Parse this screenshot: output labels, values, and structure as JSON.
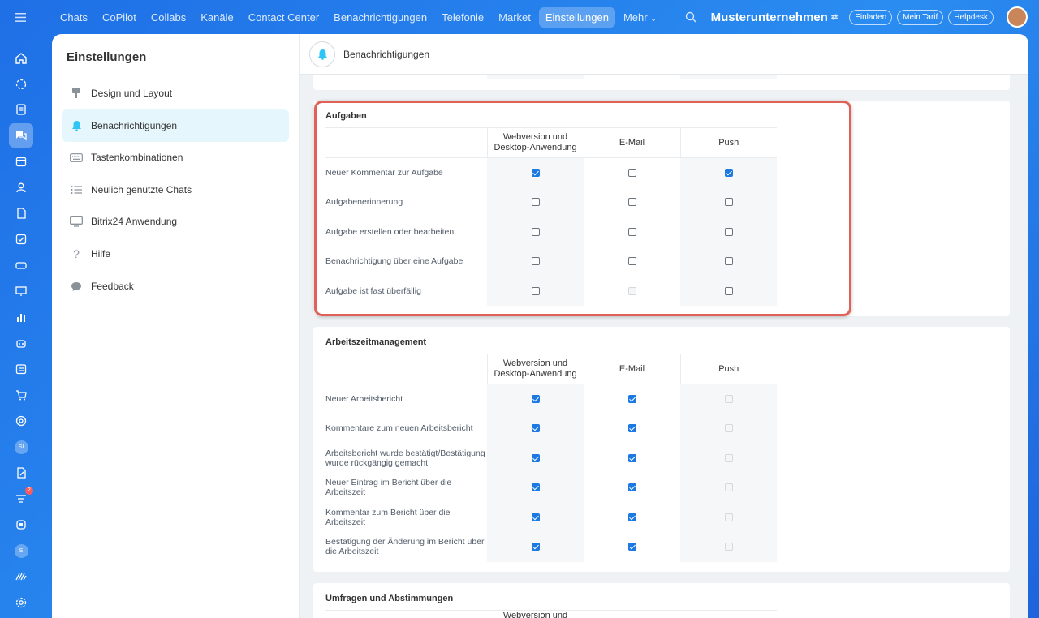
{
  "topnav": {
    "items": [
      "Chats",
      "CoPilot",
      "Collabs",
      "Kanäle",
      "Contact Center",
      "Benachrichtigungen",
      "Telefonie",
      "Market",
      "Einstellungen",
      "Mehr"
    ],
    "active_index": 8,
    "company": "Musterunternehmen",
    "buttons": [
      "Einladen",
      "Mein Tarif",
      "Helpdesk"
    ]
  },
  "rail": {
    "icons": [
      "home-icon",
      "copilot-icon",
      "feed-icon",
      "chat-icon",
      "calendar-icon",
      "contacts-icon",
      "docs-icon",
      "tasks-icon",
      "drive-icon",
      "presentation-icon",
      "analytics-icon",
      "robot-icon",
      "planner-icon",
      "shop-icon",
      "goals-icon",
      "si-avatar",
      "edit-icon",
      "filter-icon",
      "integrations-icon",
      "s-avatar",
      "bitrix-logo-icon",
      "settings-icon"
    ],
    "badge": "2",
    "circle_si": "SI",
    "circle_s": "S"
  },
  "sidebar": {
    "title": "Einstellungen",
    "items": [
      {
        "label": "Design und Layout",
        "icon": "brush-icon"
      },
      {
        "label": "Benachrichtigungen",
        "icon": "bell-icon"
      },
      {
        "label": "Tastenkombinationen",
        "icon": "keyboard-icon"
      },
      {
        "label": "Neulich genutzte Chats",
        "icon": "list-icon"
      },
      {
        "label": "Bitrix24 Anwendung",
        "icon": "monitor-icon"
      },
      {
        "label": "Hilfe",
        "icon": "question-icon"
      },
      {
        "label": "Feedback",
        "icon": "speech-bubble-icon"
      }
    ],
    "active_index": 1
  },
  "header": {
    "title": "Benachrichtigungen"
  },
  "columns": [
    "Webversion und Desktop-Anwendung",
    "E-Mail",
    "Push"
  ],
  "sections": {
    "aufgaben": {
      "title": "Aufgaben",
      "rows": [
        {
          "label": "Neuer Kommentar zur Aufgabe",
          "web": "on",
          "email": "off",
          "push": "on"
        },
        {
          "label": "Aufgabenerinnerung",
          "web": "off",
          "email": "off",
          "push": "off"
        },
        {
          "label": "Aufgabe erstellen oder bearbeiten",
          "web": "off",
          "email": "off",
          "push": "off"
        },
        {
          "label": "Benachrichtigung über eine Aufgabe",
          "web": "off",
          "email": "off",
          "push": "off"
        },
        {
          "label": "Aufgabe ist fast überfällig",
          "web": "off",
          "email": "disabled",
          "push": "off"
        }
      ]
    },
    "arbeitszeit": {
      "title": "Arbeitszeitmanagement",
      "rows": [
        {
          "label": "Neuer Arbeitsbericht",
          "web": "on",
          "email": "on",
          "push": "disabled"
        },
        {
          "label": "Kommentare zum neuen Arbeitsbericht",
          "web": "on",
          "email": "on",
          "push": "disabled"
        },
        {
          "label": "Arbeitsbericht wurde bestätigt/Bestätigung wurde rückgängig gemacht",
          "web": "on",
          "email": "on",
          "push": "disabled"
        },
        {
          "label": "Neuer Eintrag im Bericht über die Arbeitszeit",
          "web": "on",
          "email": "on",
          "push": "disabled"
        },
        {
          "label": "Kommentar zum Bericht über die Arbeitszeit",
          "web": "on",
          "email": "on",
          "push": "disabled"
        },
        {
          "label": "Bestätigung der Änderung im Bericht über die Arbeitszeit",
          "web": "on",
          "email": "on",
          "push": "disabled"
        }
      ]
    },
    "umfragen": {
      "title": "Umfragen und Abstimmungen",
      "header_visible_partial": "Webversion und"
    }
  },
  "highlight_color": "#e06157",
  "accent_color": "#1c79e3"
}
